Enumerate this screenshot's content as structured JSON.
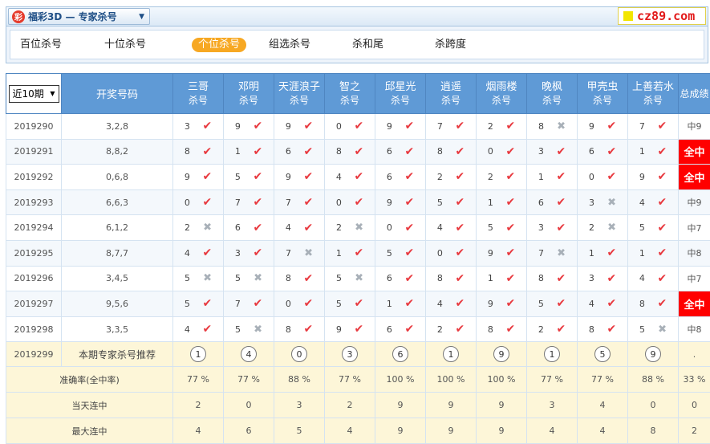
{
  "header": {
    "logo_glyph": "彩",
    "title": "福彩3D — 专家杀号",
    "chevron_icon": "chevron-down-icon",
    "brand_text": "cz89.com"
  },
  "tabs": [
    {
      "label": "百位杀号",
      "active": false
    },
    {
      "label": "十位杀号",
      "active": false
    },
    {
      "label": "个位杀号",
      "active": true
    },
    {
      "label": "组选杀号",
      "active": false
    },
    {
      "label": "杀和尾",
      "active": false
    },
    {
      "label": "杀跨度",
      "active": false
    }
  ],
  "table": {
    "period_selector": "近10期",
    "draw_header": "开奖号码",
    "total_header": "总成绩",
    "expert_sub": "杀号",
    "experts": [
      "三哥",
      "邓明",
      "天涯浪子",
      "智之",
      "邱星光",
      "逍遥",
      "烟雨楼",
      "晚枫",
      "甲壳虫",
      "上善若水"
    ],
    "rows": [
      {
        "period": "2019290",
        "draw": "3,2,8",
        "picks": [
          [
            "3",
            "ok"
          ],
          [
            "9",
            "ok"
          ],
          [
            "9",
            "ok"
          ],
          [
            "0",
            "ok"
          ],
          [
            "9",
            "ok"
          ],
          [
            "7",
            "ok"
          ],
          [
            "2",
            "ok"
          ],
          [
            "8",
            "ng"
          ],
          [
            "9",
            "ok"
          ],
          [
            "7",
            "ok"
          ]
        ],
        "total": "中9",
        "quan": false
      },
      {
        "period": "2019291",
        "draw": "8,8,2",
        "picks": [
          [
            "8",
            "ok"
          ],
          [
            "1",
            "ok"
          ],
          [
            "6",
            "ok"
          ],
          [
            "8",
            "ok"
          ],
          [
            "6",
            "ok"
          ],
          [
            "8",
            "ok"
          ],
          [
            "0",
            "ok"
          ],
          [
            "3",
            "ok"
          ],
          [
            "6",
            "ok"
          ],
          [
            "1",
            "ok"
          ]
        ],
        "total": "全中",
        "quan": true
      },
      {
        "period": "2019292",
        "draw": "0,6,8",
        "picks": [
          [
            "9",
            "ok"
          ],
          [
            "5",
            "ok"
          ],
          [
            "9",
            "ok"
          ],
          [
            "4",
            "ok"
          ],
          [
            "6",
            "ok"
          ],
          [
            "2",
            "ok"
          ],
          [
            "2",
            "ok"
          ],
          [
            "1",
            "ok"
          ],
          [
            "0",
            "ok"
          ],
          [
            "9",
            "ok"
          ]
        ],
        "total": "全中",
        "quan": true
      },
      {
        "period": "2019293",
        "draw": "6,6,3",
        "picks": [
          [
            "0",
            "ok"
          ],
          [
            "7",
            "ok"
          ],
          [
            "7",
            "ok"
          ],
          [
            "0",
            "ok"
          ],
          [
            "9",
            "ok"
          ],
          [
            "5",
            "ok"
          ],
          [
            "1",
            "ok"
          ],
          [
            "6",
            "ok"
          ],
          [
            "3",
            "ng"
          ],
          [
            "4",
            "ok"
          ]
        ],
        "total": "中9",
        "quan": false
      },
      {
        "period": "2019294",
        "draw": "6,1,2",
        "picks": [
          [
            "2",
            "ng"
          ],
          [
            "6",
            "ok"
          ],
          [
            "4",
            "ok"
          ],
          [
            "2",
            "ng"
          ],
          [
            "0",
            "ok"
          ],
          [
            "4",
            "ok"
          ],
          [
            "5",
            "ok"
          ],
          [
            "3",
            "ok"
          ],
          [
            "2",
            "ng"
          ],
          [
            "5",
            "ok"
          ]
        ],
        "total": "中7",
        "quan": false
      },
      {
        "period": "2019295",
        "draw": "8,7,7",
        "picks": [
          [
            "4",
            "ok"
          ],
          [
            "3",
            "ok"
          ],
          [
            "7",
            "ng"
          ],
          [
            "1",
            "ok"
          ],
          [
            "5",
            "ok"
          ],
          [
            "0",
            "ok"
          ],
          [
            "9",
            "ok"
          ],
          [
            "7",
            "ng"
          ],
          [
            "1",
            "ok"
          ],
          [
            "1",
            "ok"
          ]
        ],
        "total": "中8",
        "quan": false
      },
      {
        "period": "2019296",
        "draw": "3,4,5",
        "picks": [
          [
            "5",
            "ng"
          ],
          [
            "5",
            "ng"
          ],
          [
            "8",
            "ok"
          ],
          [
            "5",
            "ng"
          ],
          [
            "6",
            "ok"
          ],
          [
            "8",
            "ok"
          ],
          [
            "1",
            "ok"
          ],
          [
            "8",
            "ok"
          ],
          [
            "3",
            "ok"
          ],
          [
            "4",
            "ok"
          ]
        ],
        "total": "中7",
        "quan": false
      },
      {
        "period": "2019297",
        "draw": "9,5,6",
        "picks": [
          [
            "5",
            "ok"
          ],
          [
            "7",
            "ok"
          ],
          [
            "0",
            "ok"
          ],
          [
            "5",
            "ok"
          ],
          [
            "1",
            "ok"
          ],
          [
            "4",
            "ok"
          ],
          [
            "9",
            "ok"
          ],
          [
            "5",
            "ok"
          ],
          [
            "4",
            "ok"
          ],
          [
            "8",
            "ok"
          ]
        ],
        "total": "全中",
        "quan": true
      },
      {
        "period": "2019298",
        "draw": "3,3,5",
        "picks": [
          [
            "4",
            "ok"
          ],
          [
            "5",
            "ng"
          ],
          [
            "8",
            "ok"
          ],
          [
            "9",
            "ok"
          ],
          [
            "6",
            "ok"
          ],
          [
            "2",
            "ok"
          ],
          [
            "8",
            "ok"
          ],
          [
            "2",
            "ok"
          ],
          [
            "8",
            "ok"
          ],
          [
            "5",
            "ng"
          ]
        ],
        "total": "中8",
        "quan": false
      }
    ],
    "recommend": {
      "period": "2019299",
      "label": "本期专家杀号推荐",
      "picks": [
        "1",
        "4",
        "0",
        "3",
        "6",
        "1",
        "9",
        "1",
        "5",
        "9"
      ],
      "total": "."
    },
    "stats": [
      {
        "label": "准确率(全中率)",
        "values": [
          "77 %",
          "77 %",
          "88 %",
          "77 %",
          "100 %",
          "100 %",
          "100 %",
          "77 %",
          "77 %",
          "88 %"
        ],
        "total": "33 %"
      },
      {
        "label": "当天连中",
        "values": [
          "2",
          "0",
          "3",
          "2",
          "9",
          "9",
          "9",
          "3",
          "4",
          "0"
        ],
        "total": "0"
      },
      {
        "label": "最大连中",
        "values": [
          "4",
          "6",
          "5",
          "4",
          "9",
          "9",
          "9",
          "4",
          "4",
          "8"
        ],
        "total": "2"
      }
    ]
  },
  "icons": {
    "ok": "✔",
    "ng": "✖"
  }
}
